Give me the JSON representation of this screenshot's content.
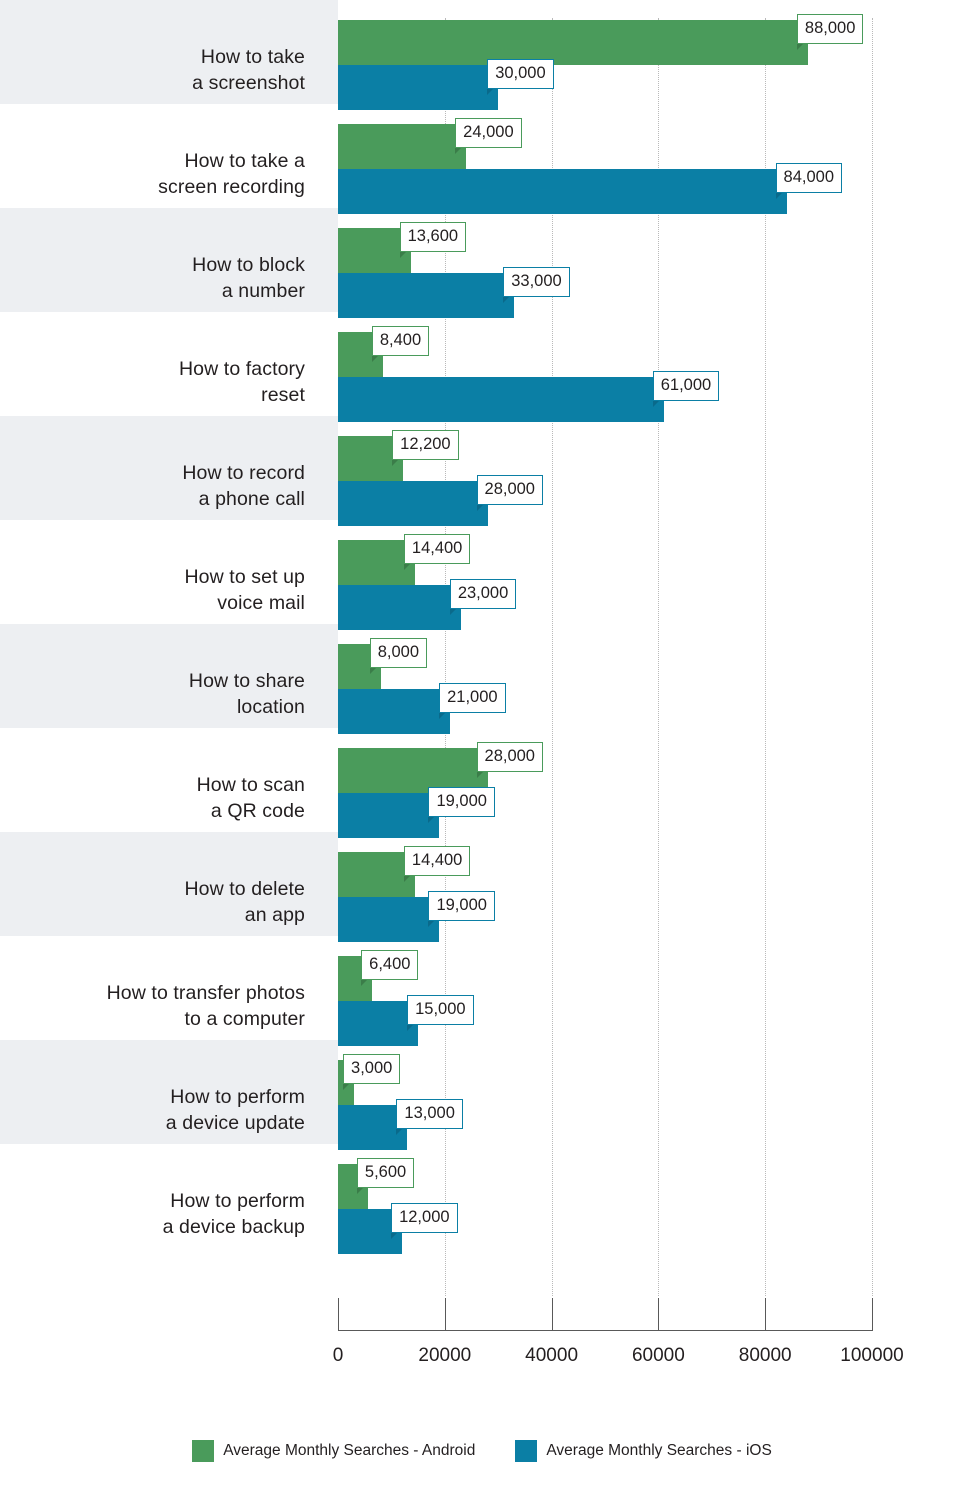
{
  "chart_data": {
    "type": "bar",
    "orientation": "horizontal",
    "title": "",
    "xlabel": "",
    "ylabel": "",
    "xlim": [
      0,
      100000
    ],
    "xticks": [
      "0",
      "20000",
      "40000",
      "60000",
      "80000",
      "100000"
    ],
    "xtick_values": [
      0,
      20000,
      40000,
      60000,
      80000,
      100000
    ],
    "grid": "vertical-dotted",
    "legend_position": "bottom-center",
    "categories": [
      "How to take\na screenshot",
      "How to take a\nscreen recording",
      "How to block\na number",
      "How to factory\nreset",
      "How to record\na phone call",
      "How to set up\nvoice mail",
      "How to share\nlocation",
      "How to scan\na QR code",
      "How to delete\nan app",
      "How to transfer photos\nto a computer",
      "How to perform\na device update",
      "How to perform\na device backup"
    ],
    "series": [
      {
        "name": "Average Monthly Searches - Android",
        "color": "#4a9b5b",
        "values": [
          88000,
          24000,
          13600,
          8400,
          12200,
          14400,
          8000,
          28000,
          14400,
          6400,
          3000,
          5600
        ],
        "labels": [
          "88,000",
          "24,000",
          "13,600",
          "8,400",
          "12,200",
          "14,400",
          "8,000",
          "28,000",
          "14,400",
          "6,400",
          "3,000",
          "5,600"
        ]
      },
      {
        "name": "Average Monthly Searches - iOS",
        "color": "#0b7fa5",
        "values": [
          30000,
          84000,
          33000,
          61000,
          28000,
          23000,
          21000,
          19000,
          19000,
          15000,
          13000,
          12000
        ],
        "labels": [
          "30,000",
          "84,000",
          "33,000",
          "61,000",
          "28,000",
          "23,000",
          "21,000",
          "19,000",
          "19,000",
          "15,000",
          "13,000",
          "12,000"
        ]
      }
    ]
  },
  "legend": {
    "items": [
      {
        "label": "Average Monthly Searches - Android",
        "color": "#4a9b5b"
      },
      {
        "label": "Average Monthly Searches - iOS",
        "color": "#0b7fa5"
      }
    ]
  },
  "colors": {
    "android": "#4a9b5b",
    "ios": "#0b7fa5",
    "band": "#edeff2",
    "text": "#231f20",
    "axis": "#595959",
    "grid": "#b9b9b9"
  }
}
